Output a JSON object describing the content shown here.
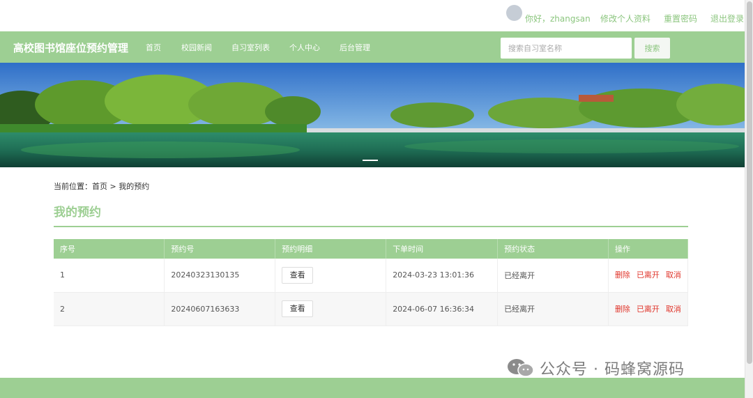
{
  "userbar": {
    "greeting": "你好，zhangsan",
    "edit_profile": "修改个人资料",
    "reset_password": "重置密码",
    "logout": "退出登录"
  },
  "nav": {
    "brand": "高校图书馆座位预约管理",
    "items": [
      "首页",
      "校园新闻",
      "自习室列表",
      "个人中心",
      "后台管理"
    ],
    "search_placeholder": "搜索自习室名称",
    "search_button": "搜索"
  },
  "breadcrumb": {
    "prefix": "当前位置：",
    "home": "首页",
    "separator": " > ",
    "current": "我的预约"
  },
  "page_title": "我的预约",
  "table": {
    "headers": [
      "序号",
      "预约号",
      "预约明细",
      "下单时间",
      "预约状态",
      "操作"
    ],
    "rows": [
      {
        "index": "1",
        "order_no": "20240323130135",
        "detail_button": "查看",
        "time": "2024-03-23 13:01:36",
        "status": "已经离开",
        "op_delete": "删除",
        "op_left": "已离开",
        "op_cancel": "取消"
      },
      {
        "index": "2",
        "order_no": "20240607163633",
        "detail_button": "查看",
        "time": "2024-06-07 16:36:34",
        "status": "已经离开",
        "op_delete": "删除",
        "op_left": "已离开",
        "op_cancel": "取消"
      }
    ]
  },
  "watermark": "公众号 · 码蜂窝源码",
  "colors": {
    "primary_green": "#9dcf93",
    "link_green": "#8cc67f",
    "danger_red": "#e0352b"
  }
}
